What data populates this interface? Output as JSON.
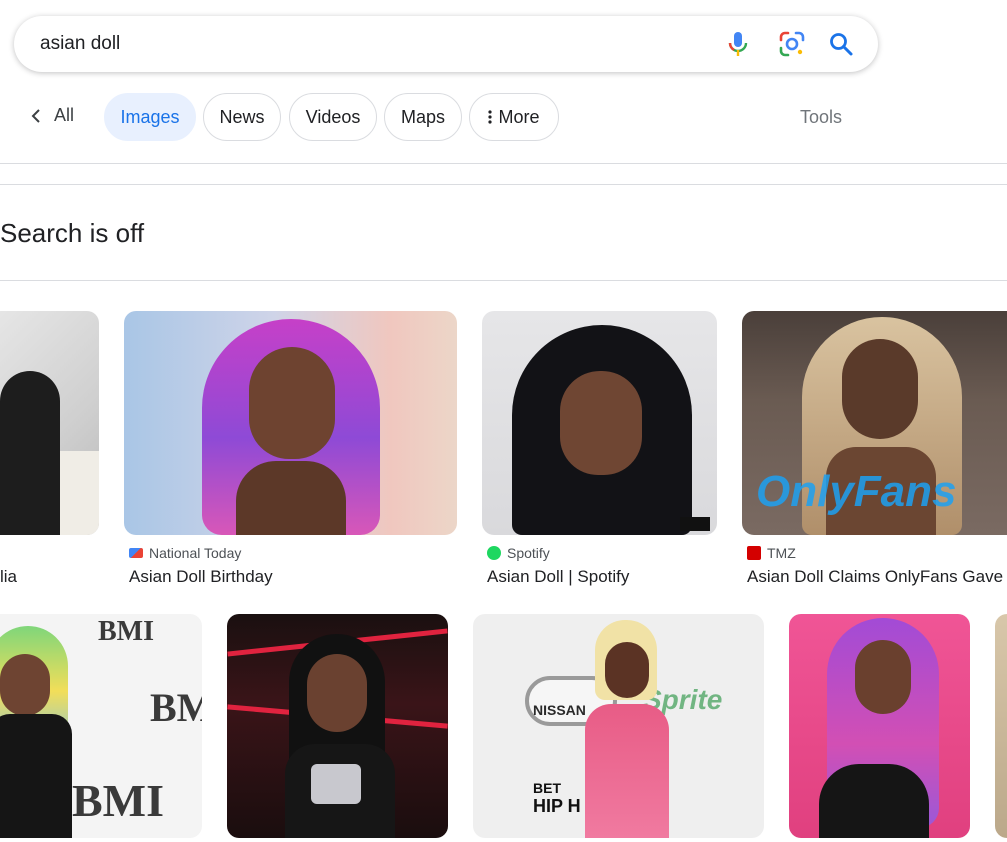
{
  "search": {
    "query": "asian doll"
  },
  "tabs": {
    "all": "All",
    "images": "Images",
    "news": "News",
    "videos": "Videos",
    "maps": "Maps",
    "more": "More",
    "tools": "Tools"
  },
  "notice": "Search is off",
  "results_row1": [
    {
      "source": "",
      "title": "lia"
    },
    {
      "source": "National Today",
      "title": "Asian Doll Birthday"
    },
    {
      "source": "Spotify",
      "title": "Asian Doll | Spotify"
    },
    {
      "source": "TMZ",
      "title": "Asian Doll Claims OnlyFans Gave"
    }
  ],
  "image_text": {
    "bmi": "BMI",
    "nissan": "NISSAN",
    "onlyfans": "OnlyFans",
    "bet": "BET",
    "hiphop": "HIP H",
    "sprite": "Sprite"
  },
  "colors": {
    "accent": "#1a73e8",
    "chip_active_bg": "#e8f0fe",
    "spotify": "#1ed760",
    "tmz": "#d40000"
  }
}
